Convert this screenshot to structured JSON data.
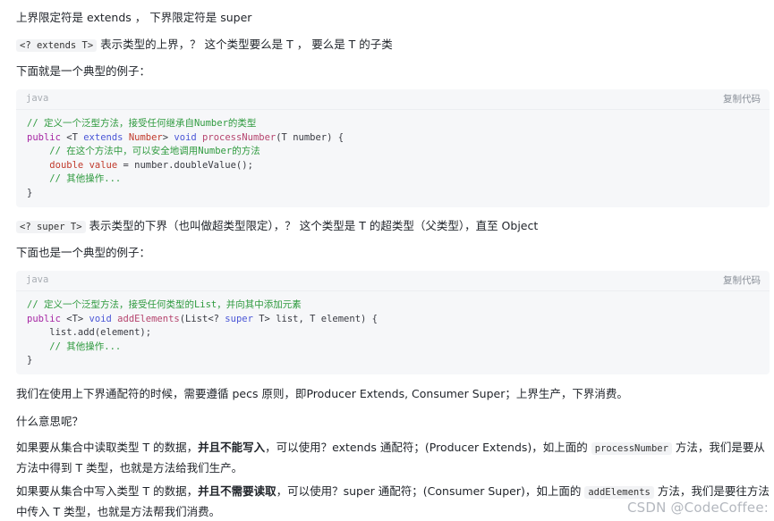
{
  "intro": {
    "line1": "上界限定符是 extends ， 下界限定符是 super",
    "upper_code": "<? extends T>",
    "upper_desc": " 表示类型的上界，？ 这个类型要么是 T ， 要么是 T 的子类",
    "example1": "下面就是一个典型的例子：",
    "lower_code": "<? super T>",
    "lower_desc": " 表示类型的下界（也叫做超类型限定），？ 这个类型是 T 的超类型（父类型），直至 Object",
    "example2": "下面也是一个典型的例子："
  },
  "code_blocks": [
    {
      "lang": "java",
      "copy_label": "复制代码",
      "lines": [
        "// 定义一个泛型方法，接受任何继承自Number的类型",
        "public <T extends Number> void processNumber(T number) {",
        "    // 在这个方法中，可以安全地调用Number的方法",
        "    double value = number.doubleValue();",
        "    // 其他操作...",
        "}"
      ]
    },
    {
      "lang": "java",
      "copy_label": "复制代码",
      "lines": [
        "// 定义一个泛型方法，接受任何类型的List，并向其中添加元素",
        "public <T> void addElements(List<? super T> list, T element) {",
        "    list.add(element);",
        "    // 其他操作...",
        "}"
      ]
    }
  ],
  "body": {
    "pecs": "我们在使用上下界通配符的时候，需要遵循 pecs 原则，即Producer Extends, Consumer Super；上界生产，下界消费。",
    "question": "什么意思呢？",
    "para1_a": "如果要从集合中读取类型 T 的数据，",
    "para1_bold": "并且不能写入",
    "para1_b": "，可以使用？extends 通配符；(Producer Extends)，如上面的 ",
    "para1_code": "processNumber",
    "para1_c": " 方法，我们是要从方法中得到 T 类型，也就是方法给我们生产。",
    "para2_a": "如果要从集合中写入类型 T 的数据，",
    "para2_bold": "并且不需要读取",
    "para2_b": "，可以使用？super 通配符；(Consumer Super)，如上面的 ",
    "para2_code": "addElements",
    "para2_c": " 方法，我们是要往方法中传入 T 类型，也就是方法帮我们消费。"
  },
  "watermark": "CSDN @CodeCoffee:"
}
